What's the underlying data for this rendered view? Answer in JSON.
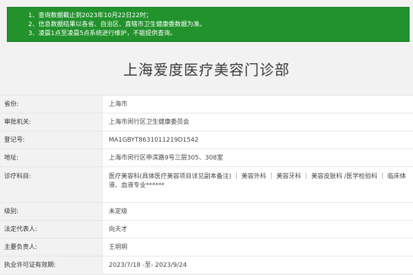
{
  "notice": {
    "lines": [
      "1、查询数据截止到2023年10月22日22时；",
      "2、信息数据结果以各省、自治区、直辖市卫生健康委数据为准。",
      "3、凌晨1点至凌晨5点系统进行维护，不能提供查询。"
    ]
  },
  "page": {
    "title": "上海爱度医疗美容门诊部"
  },
  "details": {
    "rows": [
      {
        "label": "省份:",
        "value": "上海市"
      },
      {
        "label": "审批机关:",
        "value": "上海市闵行区卫生健康委员会"
      },
      {
        "label": "登记号:",
        "value": "MA1GBYT8631011219D1542"
      },
      {
        "label": "地址:",
        "value": "上海市闵行区申滨路9号三层305、308室"
      },
      {
        "label": "诊疗科目:",
        "value": "医疗美容科(具体医疗美容项目详见副本备注) ｜ 美容外科 ｜ 美容牙科 ｜ 美容皮肤科 /医学检验科 ｜ 临床体液、血液专业******"
      },
      {
        "label": "级别:",
        "value": "未定级"
      },
      {
        "label": "法定代表人:",
        "value": "向天才"
      },
      {
        "label": "主要负责人:",
        "value": "王玥玥"
      },
      {
        "label": "执业许可证有效期:",
        "value": "2023/7/18 -至- 2023/9/24"
      }
    ]
  }
}
